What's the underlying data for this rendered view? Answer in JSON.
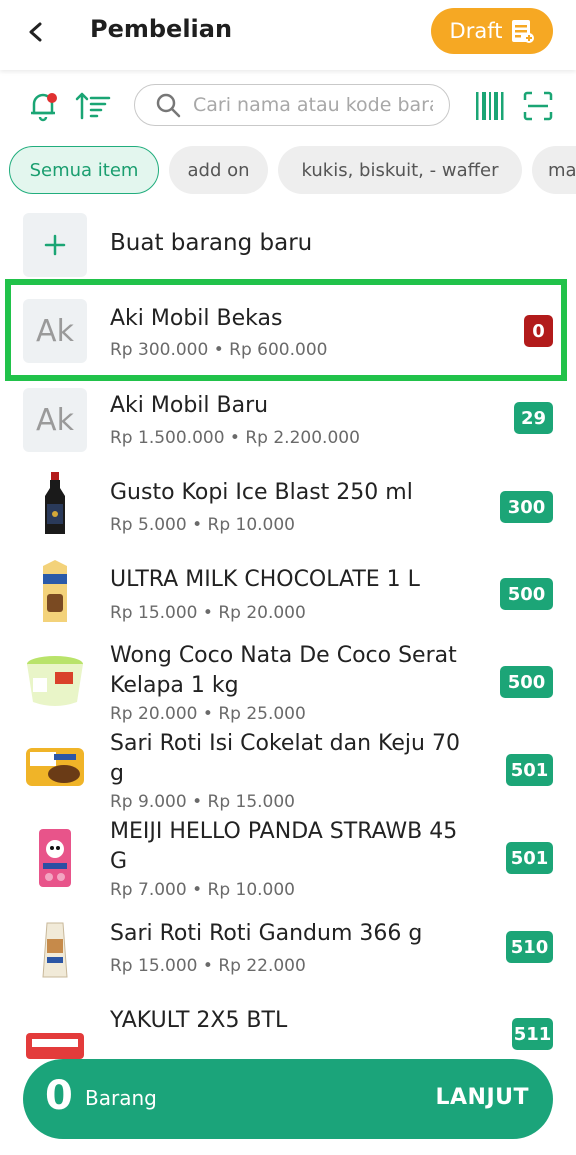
{
  "header": {
    "title": "Pembelian",
    "draft_label": "Draft"
  },
  "search": {
    "placeholder": "Cari nama atau kode barang"
  },
  "chips": [
    "Semua item",
    "add on",
    "kukis, biskuit, - waffer",
    "ma"
  ],
  "new_item_label": "Buat barang baru",
  "items": [
    {
      "name": "Aki Mobil Bekas",
      "price": "Rp 300.000 • Rp 600.000",
      "stock": "0",
      "thumb_text": "Ak"
    },
    {
      "name": "Aki Mobil Baru",
      "price": "Rp 1.500.000 • Rp 2.200.000",
      "stock": "29",
      "thumb_text": "Ak"
    },
    {
      "name": "Gusto Kopi Ice Blast 250 ml",
      "price": "Rp 5.000 • Rp 10.000",
      "stock": "300"
    },
    {
      "name": "ULTRA MILK CHOCOLATE 1 L",
      "price": "Rp 15.000 • Rp 20.000",
      "stock": "500"
    },
    {
      "name": "Wong Coco Nata De Coco Serat Kelapa 1 kg",
      "price": "Rp 20.000 • Rp 25.000",
      "stock": "500"
    },
    {
      "name": "Sari Roti Isi Cokelat dan Keju 70 g",
      "price": "Rp 9.000 • Rp 15.000",
      "stock": "501"
    },
    {
      "name": "MEIJI HELLO PANDA STRAWB 45 G",
      "price": "Rp 7.000 • Rp 10.000",
      "stock": "501"
    },
    {
      "name": "Sari Roti Roti Gandum 366 g",
      "price": "Rp 15.000 • Rp 22.000",
      "stock": "510"
    },
    {
      "name": "YAKULT 2X5 BTL",
      "price": "",
      "stock": "511"
    }
  ],
  "bottom": {
    "count": "0",
    "count_label": "Barang",
    "action": "LANJUT"
  },
  "colors": {
    "accent": "#1ba47a",
    "draft": "#f6a823",
    "zero_stock": "#b21b1b",
    "highlight": "#21c24a"
  }
}
